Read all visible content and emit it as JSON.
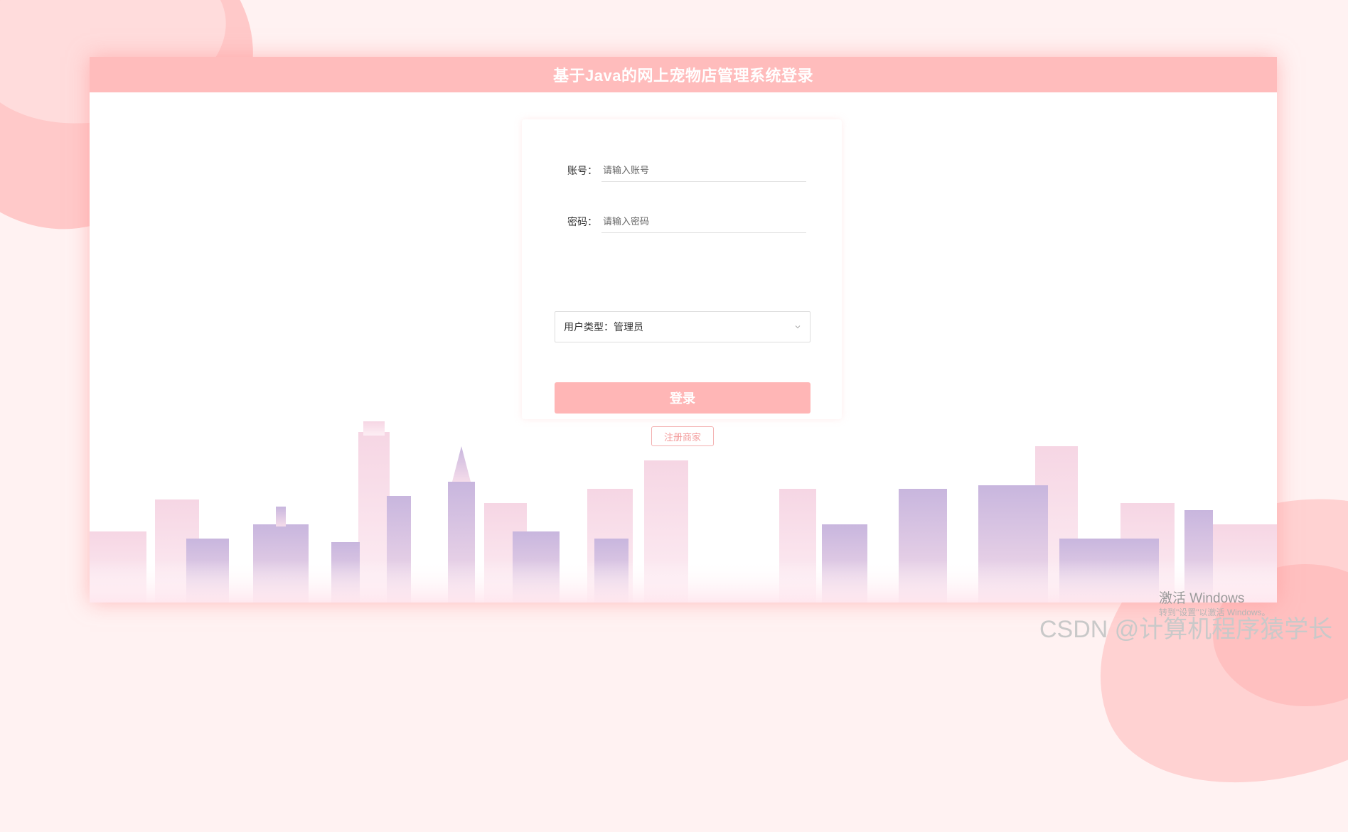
{
  "header": {
    "title": "基于Java的网上宠物店管理系统登录"
  },
  "form": {
    "account_label": "账号：",
    "account_placeholder": "请输入账号",
    "password_label": "密码：",
    "password_placeholder": "请输入密码",
    "user_type_label": "用户类型：",
    "user_type_value": "管理员",
    "login_label": "登录",
    "register_label": "注册商家"
  },
  "watermarks": {
    "windows_activate": "激活 Windows",
    "windows_sub": "转到\"设置\"以激活 Windows。",
    "csdn": "CSDN @计算机程序猿学长"
  },
  "colors": {
    "header": "#ffbcbc",
    "button": "#ffb6b6",
    "background": "#fff2f2"
  }
}
